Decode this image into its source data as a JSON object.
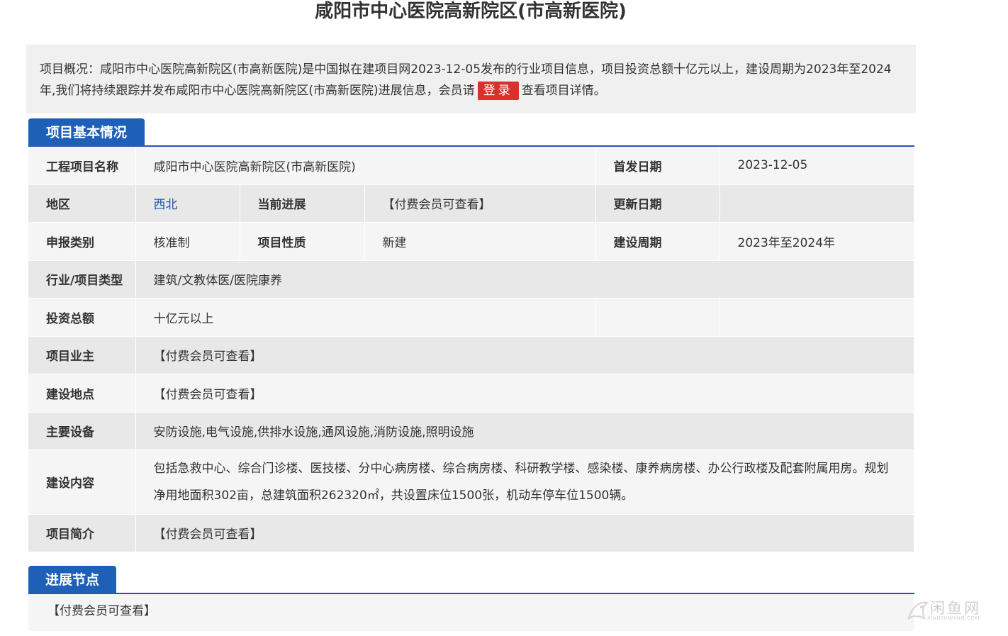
{
  "page": {
    "title": "咸阳市中心医院高新院区(市高新医院)"
  },
  "overview": {
    "text_before": "项目概况：咸阳市中心医院高新院区(市高新医院)是中国拟在建项目网2023-12-05发布的行业项目信息，项目投资总额十亿元以上，建设周期为2023年至2024年,我们将持续跟踪并发布咸阳市中心医院高新院区(市高新医院)进展信息，会员请",
    "login_label": "登录",
    "text_after": "查看项目详情。"
  },
  "basic_section": {
    "title": "项目基本情况"
  },
  "info": {
    "project_name_label": "工程项目名称",
    "project_name_value": "咸阳市中心医院高新院区(市高新医院)",
    "first_date_label": "首发日期",
    "first_date_value": "2023-12-05",
    "region_label": "地区",
    "region_value": "西北",
    "progress_label": "当前进展",
    "progress_value": "【付费会员可查看】",
    "update_date_label": "更新日期",
    "update_date_value": "",
    "filing_type_label": "申报类别",
    "filing_type_value": "核准制",
    "nature_label": "项目性质",
    "nature_value": "新建",
    "period_label": "建设周期",
    "period_value": "2023年至2024年",
    "industry_label": "行业/项目类型",
    "industry_value": "建筑/文教体医/医院康养",
    "investment_label": "投资总额",
    "investment_value": "十亿元以上",
    "owner_label": "项目业主",
    "owner_value": "【付费会员可查看】",
    "location_label": "建设地点",
    "location_value": "【付费会员可查看】",
    "equipment_label": "主要设备",
    "equipment_value": "安防设施,电气设施,供排水设施,通风设施,消防设施,照明设施",
    "content_label": "建设内容",
    "content_value": "包括急救中心、综合门诊楼、医技楼、分中心病房楼、综合病房楼、科研教学楼、感染楼、康养病房楼、办公行政楼及配套附属用房。规划净用地面积302亩，总建筑面积262320㎡，共设置床位1500张，机动车停车位1500辆。",
    "summary_label": "项目简介",
    "summary_value": "【付费会员可查看】"
  },
  "progress_section": {
    "title": "进展节点",
    "value": "【付费会员可查看】"
  },
  "watermark": {
    "text": "闲鱼网",
    "sub": "XIANYUWANG.COM"
  }
}
